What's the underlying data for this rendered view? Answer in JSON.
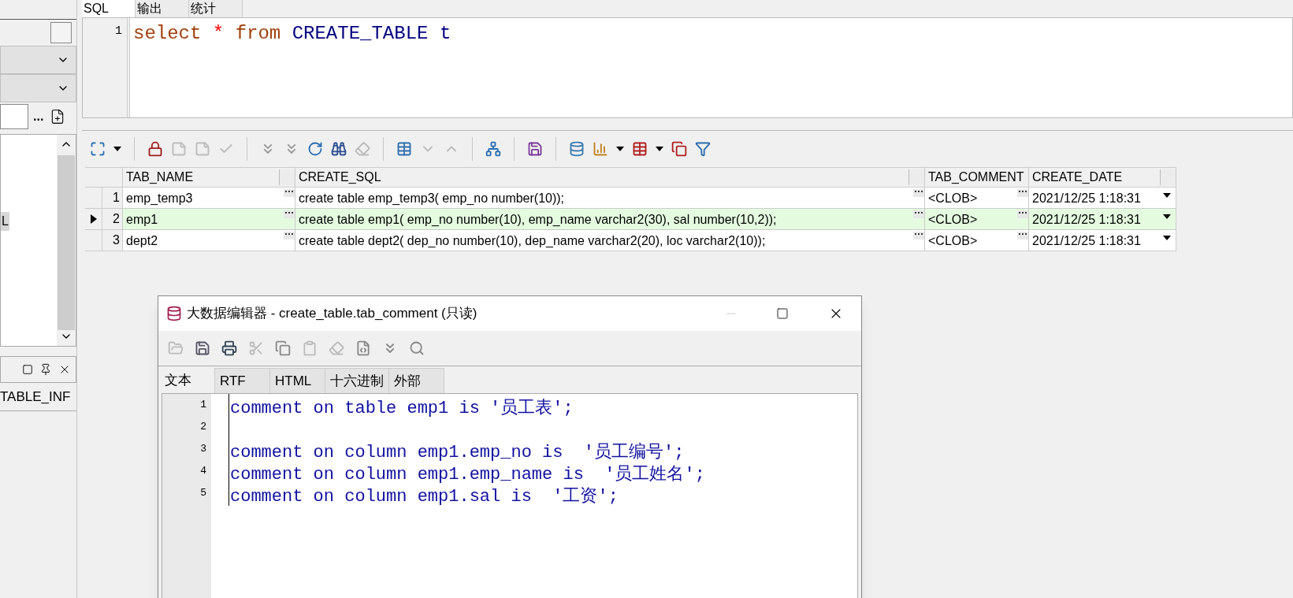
{
  "left_panel": {
    "checkbox": {
      "checked": false
    },
    "browse_button": "...",
    "list_items": [
      {
        "label": "L",
        "selected": true
      }
    ],
    "bottom_tab": "TABLE_INF"
  },
  "editor_tabs": [
    {
      "label": "SQL",
      "selected": true
    },
    {
      "label": "输出",
      "selected": false
    },
    {
      "label": "统计",
      "selected": false
    }
  ],
  "sql_editor": {
    "lines": [
      {
        "number": "1",
        "tokens": [
          {
            "text": "select",
            "kind": "keyword"
          },
          {
            "text": "*",
            "kind": "operator"
          },
          {
            "text": "from",
            "kind": "keyword"
          },
          {
            "text": "CREATE_TABLE",
            "kind": "identifier"
          },
          {
            "text": "t",
            "kind": "identifier"
          }
        ]
      }
    ]
  },
  "grid": {
    "columns": [
      "TAB_NAME",
      "CREATE_SQL",
      "TAB_COMMENT",
      "CREATE_DATE"
    ],
    "rows": [
      {
        "number": "1",
        "selected": false,
        "cells": [
          "emp_temp3",
          "create table emp_temp3( emp_no number(10));",
          "<CLOB>",
          "2021/12/25 1:18:31"
        ]
      },
      {
        "number": "2",
        "selected": true,
        "cells": [
          "emp1",
          "create table emp1( emp_no number(10), emp_name varchar2(30), sal number(10,2));",
          "<CLOB>",
          "2021/12/25 1:18:31"
        ]
      },
      {
        "number": "3",
        "selected": false,
        "cells": [
          "dept2",
          "create table dept2( dep_no number(10), dep_name varchar2(20), loc varchar2(10));",
          "<CLOB>",
          "2021/12/25 1:18:31"
        ]
      }
    ]
  },
  "dialog": {
    "title": "大数据编辑器 - create_table.tab_comment (只读)",
    "tabs": [
      {
        "label": "文本",
        "selected": true
      },
      {
        "label": "RTF",
        "selected": false
      },
      {
        "label": "HTML",
        "selected": false
      },
      {
        "label": "十六进制",
        "selected": false
      },
      {
        "label": "外部",
        "selected": false
      }
    ],
    "lines": [
      {
        "number": "1",
        "text": "comment on table emp1 is '员工表';"
      },
      {
        "number": "2"
      },
      {
        "number": "3",
        "text": "comment on column emp1.emp_no is  '员工编号';"
      },
      {
        "number": "4",
        "text": "comment on column emp1.emp_name is  '员工姓名';"
      },
      {
        "number": "5",
        "text": "comment on column emp1.sal is  '工资';"
      }
    ]
  }
}
